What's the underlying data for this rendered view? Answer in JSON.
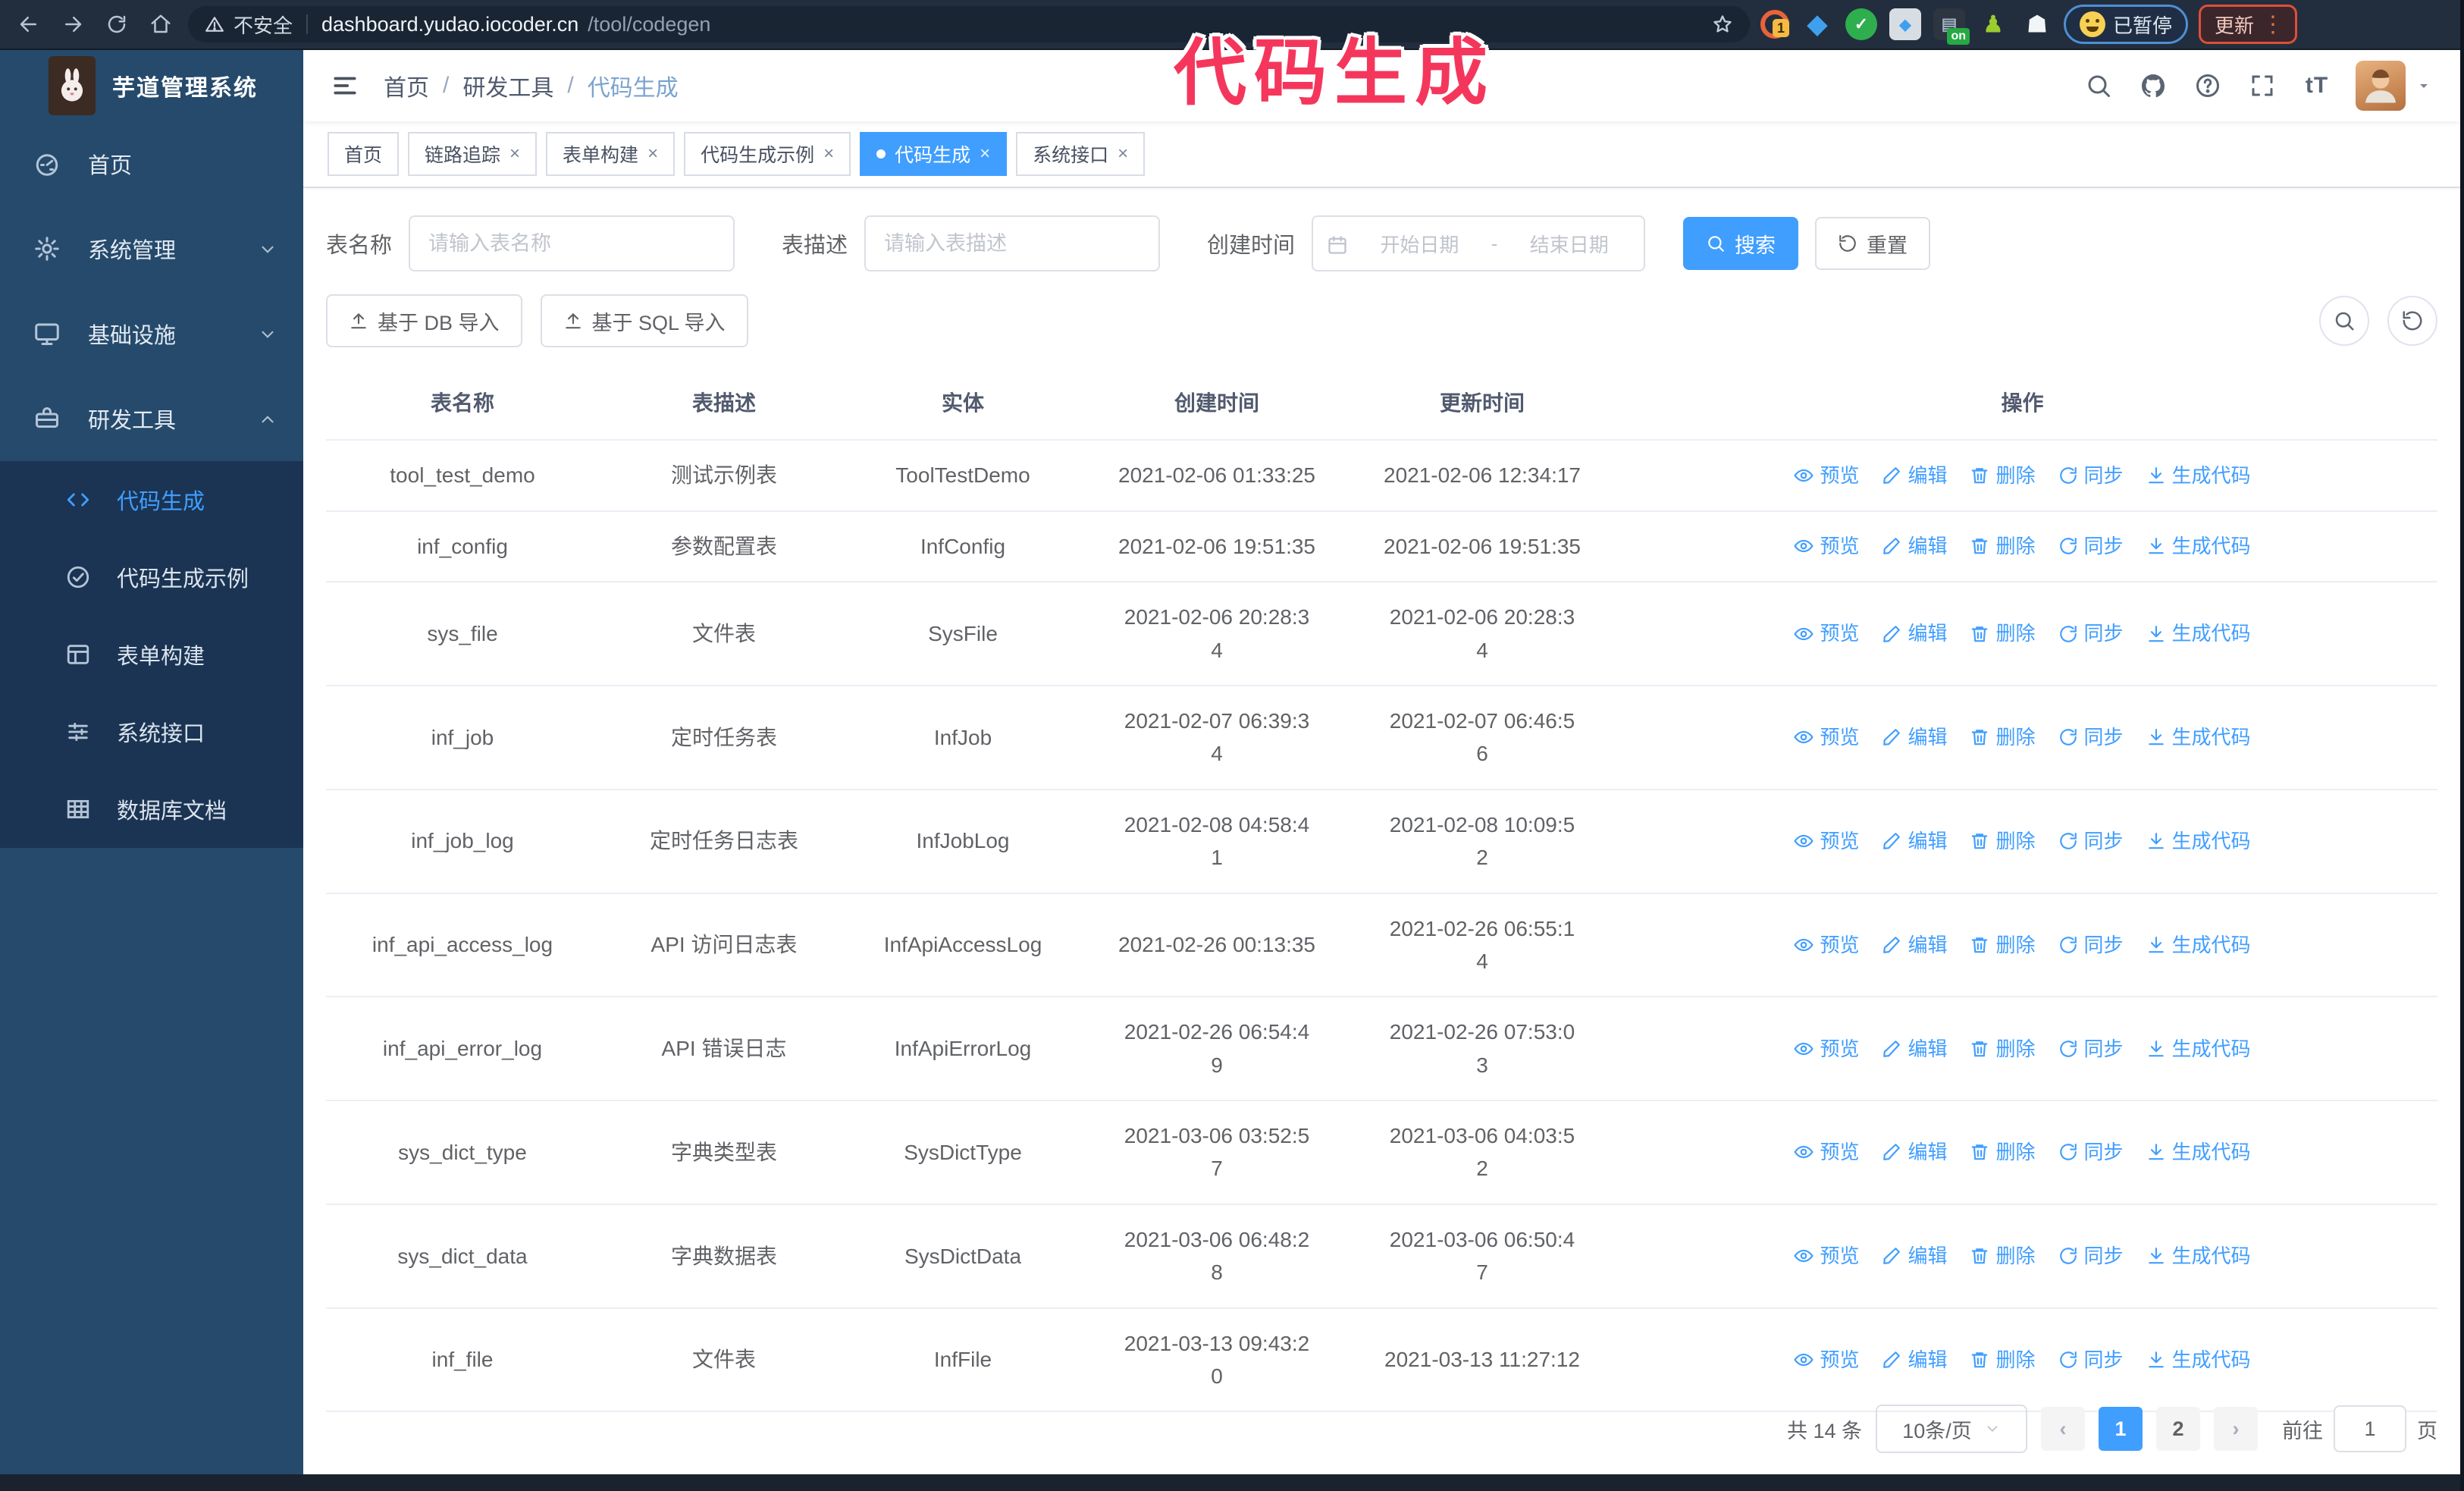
{
  "browser": {
    "security_label": "不安全",
    "url_host": "dashboard.yudao.iocoder.cn",
    "url_path": "/tool/codegen",
    "ext_badge": "1",
    "ext_on_badge": "on",
    "paused_label": "已暂停",
    "update_label": "更新"
  },
  "annotation": {
    "text": "代码生成",
    "color": "#F5365C"
  },
  "sidebar": {
    "title": "芋道管理系统",
    "items": [
      {
        "label": "首页"
      },
      {
        "label": "系统管理"
      },
      {
        "label": "基础设施"
      },
      {
        "label": "研发工具"
      }
    ],
    "sub_items": [
      {
        "label": "代码生成"
      },
      {
        "label": "代码生成示例"
      },
      {
        "label": "表单构建"
      },
      {
        "label": "系统接口"
      },
      {
        "label": "数据库文档"
      }
    ]
  },
  "breadcrumb": {
    "items": [
      "首页",
      "研发工具",
      "代码生成"
    ],
    "separator": "/"
  },
  "tabs": [
    {
      "label": "首页"
    },
    {
      "label": "链路追踪"
    },
    {
      "label": "表单构建"
    },
    {
      "label": "代码生成示例"
    },
    {
      "label": "代码生成"
    },
    {
      "label": "系统接口"
    }
  ],
  "filters": {
    "name_label": "表名称",
    "name_placeholder": "请输入表名称",
    "desc_label": "表描述",
    "desc_placeholder": "请输入表描述",
    "time_label": "创建时间",
    "start_placeholder": "开始日期",
    "range_separator": "-",
    "end_placeholder": "结束日期",
    "search_label": "搜索",
    "reset_label": "重置"
  },
  "toolbar": {
    "db_import_label": "基于 DB 导入",
    "sql_import_label": "基于 SQL 导入"
  },
  "table": {
    "headers": [
      "表名称",
      "表描述",
      "实体",
      "创建时间",
      "更新时间",
      "操作"
    ],
    "actions": [
      "预览",
      "编辑",
      "删除",
      "同步",
      "生成代码"
    ],
    "rows": [
      {
        "name": "tool_test_demo",
        "desc": "测试示例表",
        "entity": "ToolTestDemo",
        "created": "2021-02-06 01:33:25",
        "updated": "2021-02-06 12:34:17"
      },
      {
        "name": "inf_config",
        "desc": "参数配置表",
        "entity": "InfConfig",
        "created": "2021-02-06 19:51:35",
        "updated": "2021-02-06 19:51:35"
      },
      {
        "name": "sys_file",
        "desc": "文件表",
        "entity": "SysFile",
        "created": "2021-02-06 20:28:3\n4",
        "updated": "2021-02-06 20:28:3\n4"
      },
      {
        "name": "inf_job",
        "desc": "定时任务表",
        "entity": "InfJob",
        "created": "2021-02-07 06:39:3\n4",
        "updated": "2021-02-07 06:46:5\n6"
      },
      {
        "name": "inf_job_log",
        "desc": "定时任务日志表",
        "entity": "InfJobLog",
        "created": "2021-02-08 04:58:4\n1",
        "updated": "2021-02-08 10:09:5\n2"
      },
      {
        "name": "inf_api_access_log",
        "desc": "API 访问日志表",
        "entity": "InfApiAccessLog",
        "created": "2021-02-26 00:13:35",
        "updated": "2021-02-26 06:55:1\n4"
      },
      {
        "name": "inf_api_error_log",
        "desc": "API 错误日志",
        "entity": "InfApiErrorLog",
        "created": "2021-02-26 06:54:4\n9",
        "updated": "2021-02-26 07:53:0\n3"
      },
      {
        "name": "sys_dict_type",
        "desc": "字典类型表",
        "entity": "SysDictType",
        "created": "2021-03-06 03:52:5\n7",
        "updated": "2021-03-06 04:03:5\n2"
      },
      {
        "name": "sys_dict_data",
        "desc": "字典数据表",
        "entity": "SysDictData",
        "created": "2021-03-06 06:48:2\n8",
        "updated": "2021-03-06 06:50:4\n7"
      },
      {
        "name": "inf_file",
        "desc": "文件表",
        "entity": "InfFile",
        "created": "2021-03-13 09:43:2\n0",
        "updated": "2021-03-13 11:27:12"
      }
    ]
  },
  "pagination": {
    "total": "共 14 条",
    "page_size": "10条/页",
    "pages": [
      "1",
      "2"
    ],
    "goto_label": "前往",
    "goto_value": "1",
    "page_suffix": "页"
  },
  "colors": {
    "accent": "#409EFF",
    "sidebar": "#254A6C",
    "submenu": "#1B3453"
  }
}
